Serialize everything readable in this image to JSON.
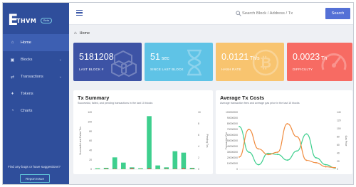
{
  "brand": {
    "mark": "E",
    "word": "THVM",
    "badge": "Beta"
  },
  "sidebar": {
    "items": [
      {
        "label": "Home",
        "icon": "home-icon",
        "glyph": "⌂",
        "active": true,
        "chevron": false
      },
      {
        "label": "Blocks",
        "icon": "cube-icon",
        "glyph": "▣",
        "active": false,
        "chevron": true
      },
      {
        "label": "Transactions",
        "icon": "exchange-icon",
        "glyph": "⇄",
        "active": false,
        "chevron": true
      },
      {
        "label": "Tokens",
        "icon": "ethereum-icon",
        "glyph": "♦",
        "active": false,
        "chevron": false
      },
      {
        "label": "Charts",
        "icon": "pie-chart-icon",
        "glyph": "◔",
        "active": false,
        "chevron": false
      }
    ],
    "bugs_text": "Find any bugs or have suggestions?",
    "report_label": "Report Issue"
  },
  "topbar": {
    "search_placeholder": "Search Block / Address / Tx",
    "search_button": "Search"
  },
  "breadcrumb": {
    "home": "Home"
  },
  "stats": [
    {
      "value": "5181208",
      "unit": "",
      "label": "LAST BLOCK #",
      "color": "#3d53a5",
      "icon": "cubes-icon"
    },
    {
      "value": "51",
      "unit": " sec",
      "label": "SINCE LAST BLOCK",
      "color": "#5fc3e6",
      "icon": "hourglass-icon"
    },
    {
      "value": "0.0121",
      "unit": " Th/s",
      "label": "HASH RATE",
      "color": "#f8c46f",
      "icon": "bitcoin-icon"
    },
    {
      "value": "0.0023",
      "unit": " Th",
      "label": "DIFFICULTY",
      "color": "#f76b63",
      "icon": "gauge-icon"
    }
  ],
  "tx_summary": {
    "title": "Tx Summary",
    "subtitle": "Successful, failed, and pending transactions in the last 10 blocks"
  },
  "gas": {
    "title": "Average Tx Costs",
    "subtitle": "Average transaction fees and average gas price in the last 10 blocks"
  },
  "chart_data": [
    {
      "type": "bar",
      "title": "Tx Summary",
      "ylabel": "Successful and Failed Txs",
      "y2label": "Pending Txs",
      "ylim": [
        0,
        120
      ],
      "y2lim": [
        0,
        10
      ],
      "yticks": [
        "0",
        "20",
        "40",
        "60",
        "80",
        "100",
        "120"
      ],
      "y2ticks": [
        "0",
        "2",
        "4",
        "6",
        "8",
        "10"
      ],
      "series": [
        {
          "name": "Successful",
          "color": "#3ecf8e",
          "values": [
            2,
            3,
            25,
            14,
            4,
            2,
            112,
            8,
            4,
            38,
            35,
            3
          ]
        },
        {
          "name": "Failed",
          "color": "#e8384f",
          "values": [
            0,
            1,
            1,
            0,
            2,
            0,
            2,
            0,
            1,
            1,
            2,
            1
          ]
        },
        {
          "name": "Pending",
          "color": "#f5a623",
          "values": [
            0,
            0,
            0,
            0,
            0,
            0,
            0,
            0,
            0,
            0,
            0,
            0
          ]
        }
      ]
    },
    {
      "type": "line",
      "title": "Average Tx Costs",
      "ylabel": "Transaction Fee",
      "y2label": "Gas Price",
      "ylim": [
        0,
        100000000
      ],
      "y2lim": [
        0,
        140
      ],
      "yticks": [
        "0",
        "10000000",
        "20000000",
        "30000000",
        "40000000",
        "50000000",
        "60000000",
        "70000000",
        "80000000",
        "90000000",
        "100000000"
      ],
      "y2ticks": [
        "0",
        "20",
        "40",
        "60",
        "80",
        "100",
        "120",
        "140"
      ],
      "series": [
        {
          "name": "Transaction Fee",
          "axis": "left",
          "color": "#3ecf8e",
          "values": [
            75000000,
            30000000,
            8000000,
            28000000,
            26000000,
            16000000,
            32000000,
            62000000,
            20000000,
            8000000,
            2000000
          ]
        },
        {
          "name": "Gas Price",
          "axis": "right",
          "color": "#f08a3c",
          "values": [
            30,
            98,
            50,
            36,
            42,
            112,
            80,
            22,
            16,
            6,
            4
          ]
        }
      ]
    }
  ]
}
